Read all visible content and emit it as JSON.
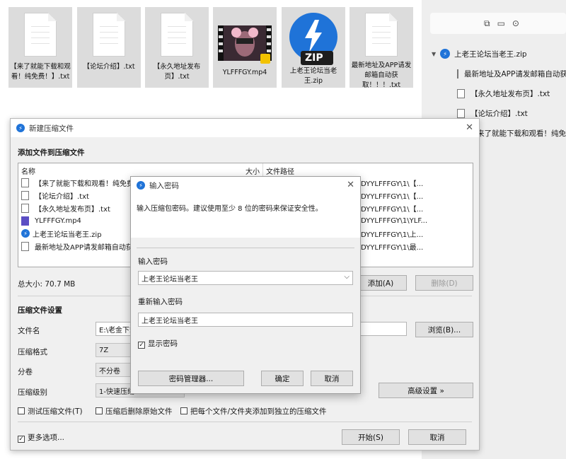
{
  "desktop": {
    "files": [
      {
        "name": "【来了就能下载和观看！纯免费！】.txt",
        "type": "txt"
      },
      {
        "name": "【论坛介绍】.txt",
        "type": "txt"
      },
      {
        "name": "【永久地址发布页】.txt",
        "type": "txt"
      },
      {
        "name": "YLFFFGY.mp4",
        "type": "video",
        "badge": "Player"
      },
      {
        "name": "上老王论坛当老王.zip",
        "type": "zip",
        "badge": "ZIP"
      },
      {
        "name": "最新地址及APP请发邮箱自动获取！！！.txt",
        "type": "txt"
      }
    ]
  },
  "side_panel": {
    "toolbar_icons": [
      "copy-icon",
      "folder-icon",
      "more-icon"
    ],
    "tree_root": "上老王论坛当老王.zip",
    "tree_items": [
      "最新地址及APP请发邮箱自动获",
      "【永久地址发布页】.txt",
      "【论坛介绍】.txt",
      "来了就能下载和观看！纯免费"
    ]
  },
  "main_dialog": {
    "title": "新建压缩文件",
    "add_section": "添加文件到压缩文件",
    "columns": {
      "name": "名称",
      "size": "大小",
      "path": "文件路径"
    },
    "rows": [
      {
        "name": "【来了就能下载和观看！纯免费",
        "path": "DYYLFFFGY\\1\\【..."
      },
      {
        "name": "【论坛介绍】.txt",
        "path": "DYYLFFFGY\\1\\【..."
      },
      {
        "name": "【永久地址发布页】.txt",
        "path": "DYYLFFFGY\\1\\【..."
      },
      {
        "name": "YLFFFGY.mp4",
        "path": "DYYLFFFGY\\1\\YLF..."
      },
      {
        "name": "上老王论坛当老王.zip",
        "path": "DYYLFFFGY\\1\\上..."
      },
      {
        "name": "最新地址及APP请发邮箱自动获",
        "path": "DYYLFFFGY\\1\\最..."
      }
    ],
    "total_size": "总大小: 70.7 MB",
    "add_button": "添加(A)",
    "delete_button": "删除(D)",
    "settings_section": "压缩文件设置",
    "filename_label": "文件名",
    "filename_value": "E:\\老金下载",
    "browse_button": "浏览(B)...",
    "format_label": "压缩格式",
    "format_value": "7Z",
    "volume_label": "分卷",
    "volume_value": "不分卷",
    "level_label": "压缩级别",
    "level_value": "1-快速压缩",
    "advanced_button": "高级设置 »",
    "test_check": "测试压缩文件(T)",
    "delete_after_check": "压缩后删除原始文件",
    "separate_check": "把每个文件/文件夹添加到独立的压缩文件",
    "more_options": "更多选项...",
    "start_button": "开始(S)",
    "cancel_button": "取消"
  },
  "password_dialog": {
    "title": "输入密码",
    "hint": "输入压缩包密码。建议使用至少 8 位的密码来保证安全性。",
    "pwd_label": "输入密码",
    "pwd_value": "上老王论坛当老王",
    "confirm_label": "重新输入密码",
    "confirm_value": "上老王论坛当老王",
    "show_pwd": "显示密码",
    "show_pwd_checked": true,
    "manager_button": "密码管理器...",
    "ok_button": "确定",
    "cancel_button": "取消"
  },
  "colors": {
    "accent": "#1f73d8",
    "dialog_bg": "#f0f0f0",
    "side_bg": "#eeeeee"
  }
}
